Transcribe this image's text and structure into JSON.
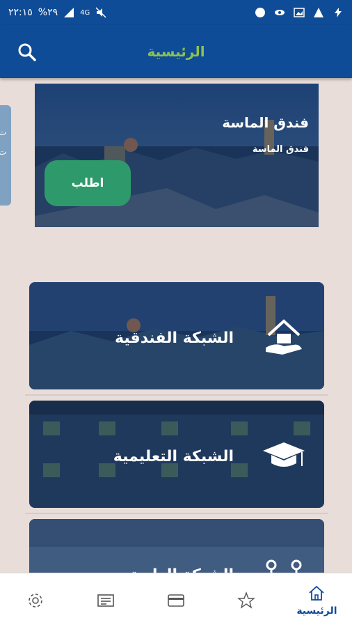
{
  "status_bar": {
    "time": "٢٢:١٥",
    "battery": "%٢٩",
    "network": "4G"
  },
  "app_bar": {
    "title": "الرئيسية"
  },
  "hero": {
    "title": "فندق الماسة",
    "subtitle": "فندق الماسة",
    "order_button": "اطلب"
  },
  "side_tab": {
    "text": "ت\nت"
  },
  "cards": [
    {
      "title": "الشبكة الفندقية",
      "icon": "house-hand-icon"
    },
    {
      "title": "الشبكة التعليمية",
      "icon": "graduation-cap-icon"
    },
    {
      "title": "الشبكة الطبية",
      "icon": "hospital-network-icon"
    }
  ],
  "bottom_nav": {
    "items": [
      {
        "label": "الرئيسية",
        "icon": "home-icon",
        "active": true
      },
      {
        "label": "",
        "icon": "star-icon"
      },
      {
        "label": "",
        "icon": "card-icon"
      },
      {
        "label": "",
        "icon": "news-icon"
      },
      {
        "label": "",
        "icon": "settings-icon"
      }
    ]
  },
  "colors": {
    "primary": "#0f4c97",
    "title_green": "#8cc152",
    "button_green": "#2e9a6b",
    "background": "#e8ddd8"
  }
}
